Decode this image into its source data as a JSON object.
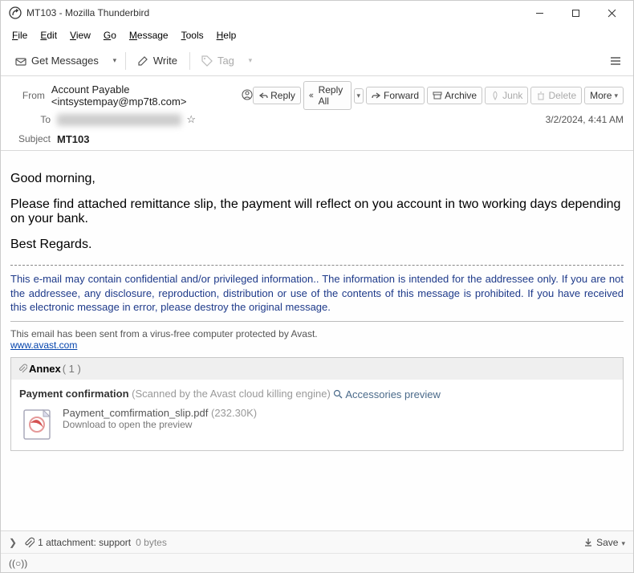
{
  "window": {
    "title": "MT103 - Mozilla Thunderbird"
  },
  "menu": {
    "file": "File",
    "edit": "Edit",
    "view": "View",
    "go": "Go",
    "message": "Message",
    "tools": "Tools",
    "help": "Help"
  },
  "toolbar": {
    "get_messages": "Get Messages",
    "write": "Write",
    "tag": "Tag"
  },
  "actions": {
    "reply": "Reply",
    "reply_all": "Reply All",
    "forward": "Forward",
    "archive": "Archive",
    "junk": "Junk",
    "delete": "Delete",
    "more": "More"
  },
  "headers": {
    "from_label": "From",
    "from_value": "Account Payable <intsystempay@mp7t8.com>",
    "to_label": "To",
    "to_value": "recipient hidden",
    "subject_label": "Subject",
    "subject_value": "MT103",
    "date": "3/2/2024, 4:41 AM"
  },
  "body": {
    "p1": "Good morning,",
    "p2": "Please find attached remittance slip, the payment will reflect on you account in two working days depending on your bank.",
    "p3": "Best Regards.",
    "disclaimer": "This e-mail may contain confidential and/or privileged information.. The information is intended for the addressee only. If you are not the addressee, any disclosure, reproduction, distribution or use of the contents of this message is prohibited. If you have received this electronic message in error, please destroy the original message.",
    "avast": "This email has been sent from a virus-free computer protected by Avast.",
    "avast_link": "www.avast.com"
  },
  "annex": {
    "title": "Annex",
    "count": "( 1 )",
    "section": "Payment confirmation",
    "scanned": "(Scanned by the Avast cloud killing engine)",
    "preview": "Accessories preview",
    "filename": "Payment_comfirmation_slip.pdf",
    "filesize": "(232.30K)",
    "download_hint": "Download to open the preview"
  },
  "footer": {
    "attachment_text": "1 attachment: support",
    "attachment_size": "0 bytes",
    "save": "Save"
  }
}
